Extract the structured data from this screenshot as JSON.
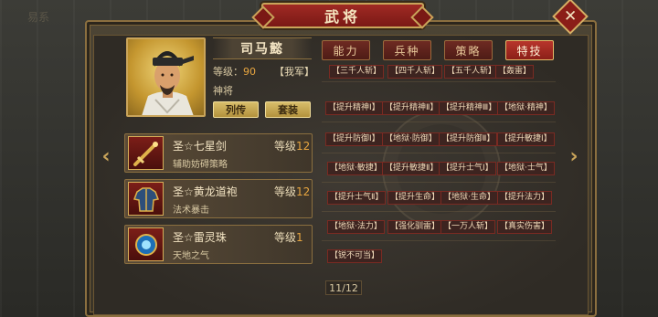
{
  "background": {
    "tab_text": "易系"
  },
  "title": "武将",
  "hero": {
    "name": "司马懿",
    "level_label": "等级：",
    "level_value": "90",
    "faction": "【我军】",
    "rank": "神将",
    "biography_button": "列传",
    "set_button": "套装"
  },
  "equipment": [
    {
      "name": "圣☆七星剑",
      "level_label": "等级",
      "level": "12",
      "desc": "辅助妨碍策略",
      "icon": "sword-icon"
    },
    {
      "name": "圣☆黄龙道袍",
      "level_label": "等级",
      "level": "12",
      "desc": "法术暴击",
      "icon": "robe-icon"
    },
    {
      "name": "圣☆雷灵珠",
      "level_label": "等级",
      "level": "1",
      "desc": "天地之气",
      "icon": "orb-icon"
    }
  ],
  "tabs": [
    {
      "label": "能力",
      "active": false
    },
    {
      "label": "兵种",
      "active": false
    },
    {
      "label": "策略",
      "active": false
    },
    {
      "label": "特技",
      "active": true
    }
  ],
  "skills": [
    [
      "【三千人斩】",
      "【四千人斩】",
      "【五千人斩】",
      "【轰雷】"
    ],
    [
      "【提升精神Ⅰ】",
      "【提升精神Ⅱ】",
      "【提升精神Ⅲ】",
      "【地狱·精神】"
    ],
    [
      "【提升防御Ⅰ】",
      "【地狱·防御】",
      "【提升防御Ⅱ】",
      "【提升敏捷Ⅰ】"
    ],
    [
      "【地狱·敏捷】",
      "【提升敏捷Ⅱ】",
      "【提升士气Ⅰ】",
      "【地狱·士气】"
    ],
    [
      "【提升士气Ⅱ】",
      "【提升生命】",
      "【地狱·生命】",
      "【提升法力】"
    ],
    [
      "【地狱·法力】",
      "【强化驯雷】",
      "【一万人斩】",
      "【真实伤害】"
    ],
    [
      "【锐不可当】"
    ]
  ],
  "page_indicator": "11/12",
  "nav": {
    "prev": "‹",
    "next": "›"
  },
  "close_label": "✕",
  "colors": {
    "accent_red": "#8b1f18",
    "gold": "#c9a45a",
    "level_orange": "#e8a640"
  }
}
